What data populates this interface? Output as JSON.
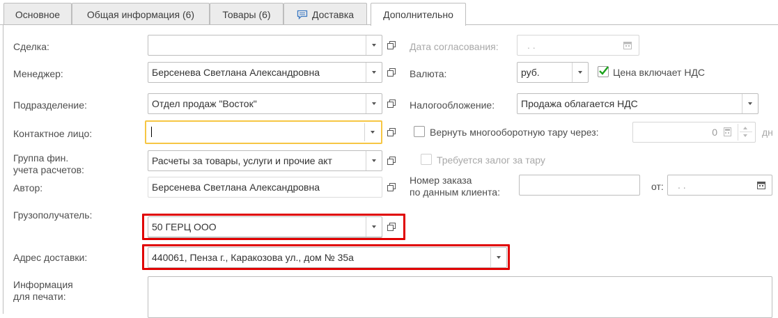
{
  "tabs": [
    {
      "label": "Основное",
      "active": false
    },
    {
      "label": "Общая информация (6)",
      "active": false
    },
    {
      "label": "Товары (6)",
      "active": false
    },
    {
      "label": "Доставка",
      "active": false,
      "icon": "comment-icon"
    },
    {
      "label": "Дополнительно",
      "active": true
    }
  ],
  "left": {
    "deal": {
      "label": "Сделка:",
      "value": ""
    },
    "manager": {
      "label": "Менеджер:",
      "value": "Берсенева Светлана Александровна"
    },
    "department": {
      "label": "Подразделение:",
      "value": "Отдел продаж \"Восток\""
    },
    "contact": {
      "label": "Контактное лицо:",
      "value": ""
    },
    "fin_group": {
      "label_line1": "Группа фин.",
      "label_line2": "учета расчетов:",
      "value": "Расчеты за товары, услуги и прочие акт"
    },
    "author": {
      "label": "Автор:",
      "value": "Берсенева Светлана Александровна"
    },
    "consignee": {
      "label": "Грузополучатель:",
      "value": "50 ГЕРЦ ООО"
    },
    "delivery_address": {
      "label": "Адрес доставки:",
      "value": "440061, Пенза г., Каракозова ул., дом № 35а"
    },
    "print_info": {
      "label_line1": "Информация",
      "label_line2": "для печати:",
      "value": ""
    }
  },
  "right": {
    "approval_date": {
      "label": "Дата согласования:",
      "value": ". ."
    },
    "currency": {
      "label": "Валюта:",
      "value": "руб."
    },
    "price_incl_vat": {
      "label": "Цена включает НДС",
      "checked": true
    },
    "taxation": {
      "label": "Налогообложение:",
      "value": "Продажа облагается НДС"
    },
    "return_tare": {
      "label": "Вернуть многооборотную тару через:",
      "checked": false,
      "value": "0",
      "unit": "дн"
    },
    "deposit": {
      "label": "Требуется залог за тару",
      "checked": false
    },
    "order_number": {
      "label_line1": "Номер заказа",
      "label_line2": "по данным клиента:",
      "value": "",
      "from_label": "от:",
      "date_value": ". ."
    }
  },
  "colors": {
    "accent_check": "#1aa11a",
    "highlight_red": "#e00000",
    "focus_yellow": "#f6c643"
  }
}
